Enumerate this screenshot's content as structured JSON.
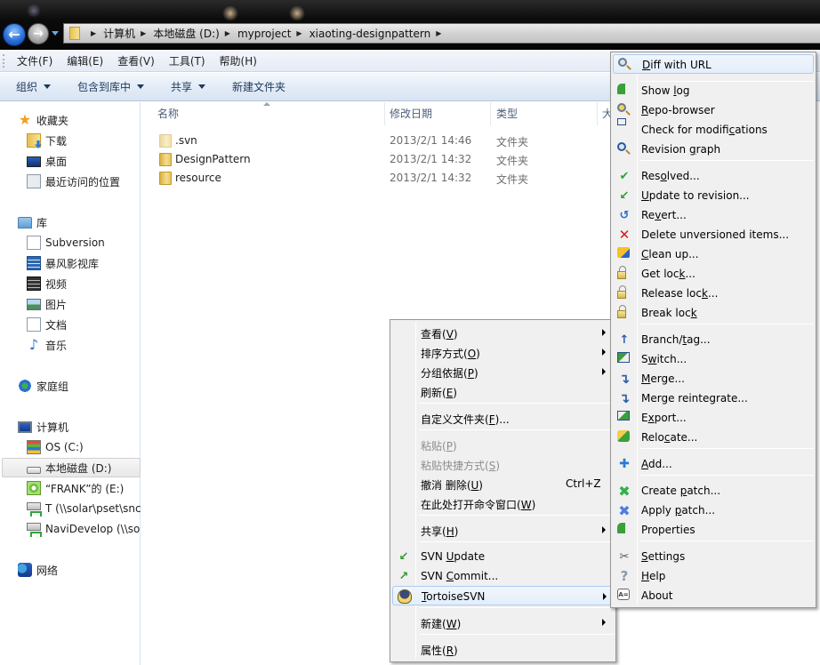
{
  "window": {
    "breadcrumb": [
      "计算机",
      "本地磁盘 (D:)",
      "myproject",
      "xiaoting-designpattern"
    ]
  },
  "menubar": {
    "items": [
      "文件(F)",
      "编辑(E)",
      "查看(V)",
      "工具(T)",
      "帮助(H)"
    ]
  },
  "commandbar": {
    "organize": "组织",
    "include_library": "包含到库中",
    "share": "共享",
    "new_folder": "新建文件夹"
  },
  "navpane": {
    "favorites": {
      "label": "收藏夹",
      "items": [
        "下载",
        "桌面",
        "最近访问的位置"
      ]
    },
    "libraries": {
      "label": "库",
      "items": [
        "Subversion",
        "暴风影视库",
        "视频",
        "图片",
        "文档",
        "音乐"
      ]
    },
    "homegroup": "家庭组",
    "computer": {
      "label": "计算机",
      "items": [
        "OS (C:)",
        "本地磁盘 (D:)",
        "“FRANK”的 (E:)",
        "T (\\\\solar\\pset\\snc",
        "NaviDevelop (\\\\so"
      ]
    },
    "network": "网络",
    "selected": "本地磁盘 (D:)"
  },
  "filelist": {
    "columns": [
      "名称",
      "修改日期",
      "类型",
      "大"
    ],
    "rows": [
      {
        "name": ".svn",
        "date": "2013/2/1 14:46",
        "type": "文件夹"
      },
      {
        "name": "DesignPattern",
        "date": "2013/2/1 14:32",
        "type": "文件夹"
      },
      {
        "name": "resource",
        "date": "2013/2/1 14:32",
        "type": "文件夹"
      }
    ]
  },
  "context_menu": {
    "items": [
      {
        "label": "查看(V)",
        "hotkey": "V",
        "submenu": true
      },
      {
        "label": "排序方式(O)",
        "hotkey": "O",
        "submenu": true
      },
      {
        "label": "分组依据(P)",
        "hotkey": "P",
        "submenu": true
      },
      {
        "label": "刷新(E)",
        "hotkey": "E"
      },
      {
        "label": "自定义文件夹(F)...",
        "hotkey": "F"
      },
      {
        "label": "粘贴(P)",
        "hotkey": "P",
        "disabled": true
      },
      {
        "label": "粘贴快捷方式(S)",
        "hotkey": "S",
        "disabled": true
      },
      {
        "label": "撤消 删除(U)",
        "hotkey": "U",
        "shortcut": "Ctrl+Z"
      },
      {
        "label": "在此处打开命令窗口(W)",
        "hotkey": "W"
      },
      {
        "label": "共享(H)",
        "hotkey": "H",
        "submenu": true
      },
      {
        "label": "SVN Update",
        "hotkey": "U",
        "icon": "svn-update-icon"
      },
      {
        "label": "SVN Commit...",
        "hotkey": "C",
        "icon": "svn-commit-icon"
      },
      {
        "label": "TortoiseSVN",
        "hotkey": "T",
        "icon": "tortoisesvn-icon",
        "submenu": true,
        "highlighted": true
      },
      {
        "label": "新建(W)",
        "hotkey": "W",
        "submenu": true
      },
      {
        "label": "属性(R)",
        "hotkey": "R"
      }
    ]
  },
  "tortoise_menu": {
    "items": [
      {
        "label": "Diff with URL",
        "icon": "diff-icon",
        "highlighted": true
      },
      {
        "label": "Show log",
        "icon": "show-log-icon"
      },
      {
        "label": "Repo-browser",
        "icon": "repo-browser-icon"
      },
      {
        "label": "Check for modifications",
        "icon": "check-modifications-icon"
      },
      {
        "label": "Revision graph",
        "icon": "revision-graph-icon"
      },
      {
        "label": "Resolved...",
        "icon": "resolved-icon"
      },
      {
        "label": "Update to revision...",
        "icon": "update-revision-icon"
      },
      {
        "label": "Revert...",
        "icon": "revert-icon"
      },
      {
        "label": "Delete unversioned items...",
        "icon": "delete-icon"
      },
      {
        "label": "Clean up...",
        "icon": "cleanup-icon"
      },
      {
        "label": "Get lock...",
        "icon": "lock-icon"
      },
      {
        "label": "Release lock...",
        "icon": "unlock-icon"
      },
      {
        "label": "Break lock",
        "icon": "break-lock-icon"
      },
      {
        "label": "Branch/tag...",
        "icon": "branch-icon"
      },
      {
        "label": "Switch...",
        "icon": "switch-icon"
      },
      {
        "label": "Merge...",
        "icon": "merge-icon"
      },
      {
        "label": "Merge reintegrate...",
        "icon": "merge-reintegrate-icon"
      },
      {
        "label": "Export...",
        "icon": "export-icon"
      },
      {
        "label": "Relocate...",
        "icon": "relocate-icon"
      },
      {
        "label": "Add...",
        "icon": "add-icon"
      },
      {
        "label": "Create patch...",
        "icon": "create-patch-icon"
      },
      {
        "label": "Apply patch...",
        "icon": "apply-patch-icon"
      },
      {
        "label": "Properties",
        "icon": "properties-icon"
      },
      {
        "label": "Settings",
        "icon": "settings-icon"
      },
      {
        "label": "Help",
        "icon": "help-icon"
      },
      {
        "label": "About",
        "icon": "about-icon"
      }
    ]
  },
  "colors": {
    "menu_bg": "#f0f0f0",
    "highlight_border": "#aecbf0",
    "cmd_text": "#1e395b"
  }
}
